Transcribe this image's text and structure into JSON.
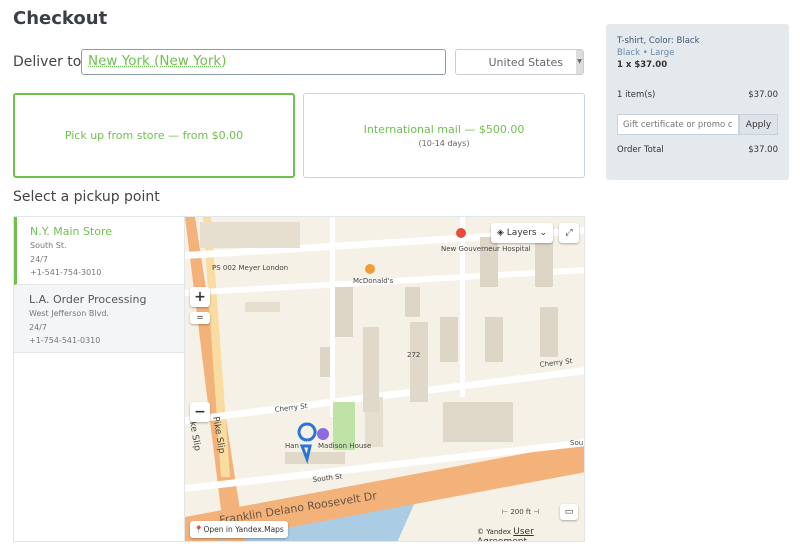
{
  "title": "Checkout",
  "deliver": {
    "label": "Deliver to",
    "city": "New York (New York)",
    "country": "United States"
  },
  "options": [
    {
      "label": "Pick up from store — from $0.00",
      "selected": true
    },
    {
      "label": "International mail — $500.00",
      "note": "(10-14 days)"
    }
  ],
  "pickup_heading": "Select a pickup point",
  "points": [
    {
      "name": "N.Y. Main Store",
      "address": "South St.",
      "hours": "24/7",
      "phone": "+1-541-754-3010"
    },
    {
      "name": "L.A. Order Processing",
      "address": "West Jefferson Blvd.",
      "hours": "24/7",
      "phone": "+1-754-541-0310"
    }
  ],
  "map": {
    "layers": "Layers",
    "zoom_in": "+",
    "zoom_out": "−",
    "open": "Open in Yandex.Maps",
    "copyright": "© Yandex",
    "agreement": "User Agreement",
    "scale": "200 ft",
    "labels": {
      "school": "PS 002 Meyer London",
      "mcdonalds": "McDonald's",
      "hospital": "New Gouverneur Hospital",
      "cherry1": "Cherry St",
      "cherry2": "Cherry St",
      "madison": "Madison House",
      "han": "Han",
      "south": "South St",
      "south2": "Sou",
      "fdr": "Franklin Delano Roosevelt Dr",
      "pike1": "Pike Slip",
      "pike2": "ke Slip",
      "num": "272"
    }
  },
  "summary": {
    "item": "T-shirt, Color: Black",
    "variant": "Black • Large",
    "qty": "1 x $37.00",
    "items_label": "1 item(s)",
    "items_total": "$37.00",
    "promo_placeholder": "Gift certificate or promo code",
    "apply": "Apply",
    "total_label": "Order Total",
    "total": "$37.00"
  }
}
